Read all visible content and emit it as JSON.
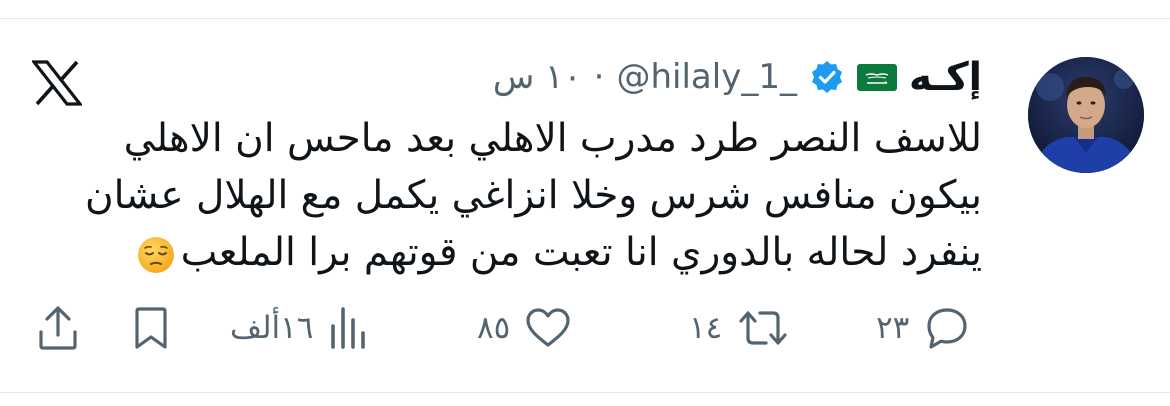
{
  "tweet": {
    "author": {
      "display_name": "إكـه",
      "handle": "@hilaly_1_",
      "flag": "saudi-arabia-flag",
      "verified": true
    },
    "separator": "·",
    "time": "١٠ س",
    "text_lines": [
      "للاسف النصر طرد مدرب الاهلي بعد ماحس ان الاهلي",
      "بيكون منافس شرس وخلا انزاغي يكمل مع الهلال عشان",
      "ينفرد لحاله بالدوري انا تعبت من قوتهم برا الملعب"
    ],
    "emoji": "pensive-face"
  },
  "actions": {
    "replies": "٢٣",
    "retweets": "١٤",
    "likes": "٨٥",
    "views": "١٦ألف"
  },
  "brand": {
    "icon": "x-logo-icon"
  },
  "colors": {
    "verified": "#1d9bf0",
    "secondary_text": "#536471",
    "text": "#0f1419"
  }
}
